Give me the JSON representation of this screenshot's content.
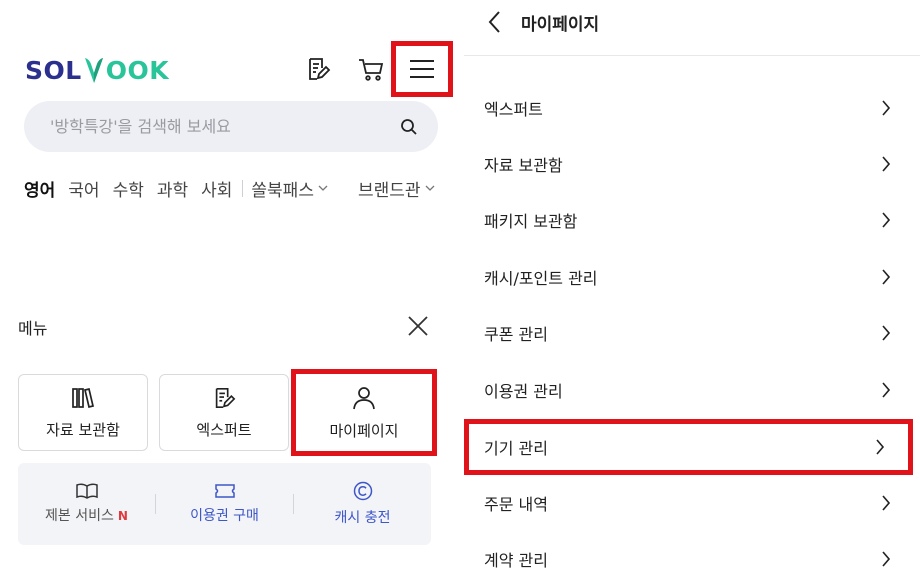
{
  "left": {
    "logo": {
      "part1": "SOL",
      "part2": "OOK"
    },
    "header_icons": [
      "write-icon",
      "cart-icon",
      "hamburger-icon"
    ],
    "search": {
      "placeholder": "'방학특강'을 검색해 보세요"
    },
    "subjects": [
      {
        "label": "영어",
        "active": true
      },
      {
        "label": "국어"
      },
      {
        "label": "수학"
      },
      {
        "label": "과학"
      },
      {
        "label": "사회"
      }
    ],
    "dropdowns": [
      "쏠북패스",
      "브랜드관"
    ],
    "menu": {
      "title": "메뉴",
      "tiles": [
        {
          "label": "자료 보관함",
          "icon": "books-icon"
        },
        {
          "label": "엑스퍼트",
          "icon": "edit-note-icon"
        },
        {
          "label": "마이페이지",
          "icon": "person-icon"
        }
      ],
      "services": [
        {
          "label": "제본 서비스",
          "badge": "N",
          "icon": "open-book-icon"
        },
        {
          "label": "이용권 구매",
          "icon": "ticket-icon"
        },
        {
          "label": "캐시 충전",
          "icon": "copyright-icon"
        }
      ]
    }
  },
  "right": {
    "title": "마이페이지",
    "items": [
      {
        "label": "엑스퍼트"
      },
      {
        "label": "자료 보관함"
      },
      {
        "label": "패키지 보관함"
      },
      {
        "label": "캐시/포인트 관리"
      },
      {
        "label": "쿠폰 관리"
      },
      {
        "label": "이용권 관리"
      },
      {
        "label": "기기 관리",
        "highlighted": true
      },
      {
        "label": "주문 내역"
      },
      {
        "label": "계약 관리"
      }
    ]
  },
  "colors": {
    "brand_navy": "#2b2f8e",
    "brand_green": "#29c49a",
    "highlight_red": "#e0131a",
    "accent_blue": "#3d56c8",
    "new_badge": "#e0393e"
  }
}
